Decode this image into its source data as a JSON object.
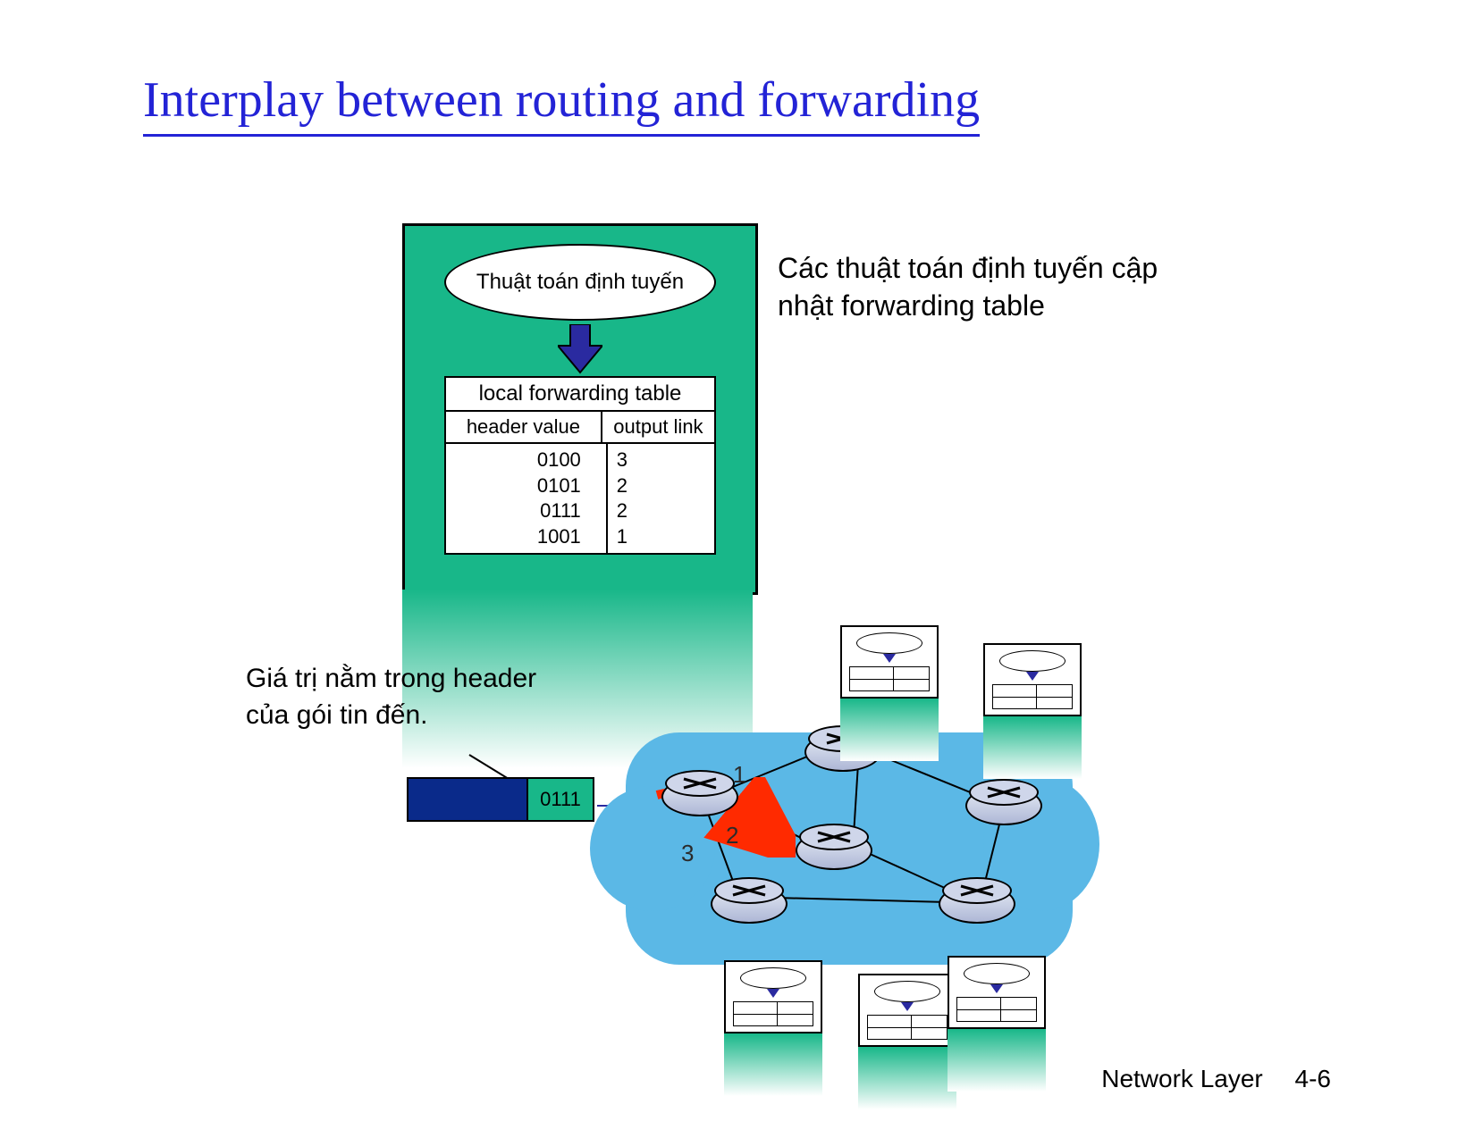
{
  "title": "Interplay between routing and forwarding",
  "caption_line1": "Các thuật toán định tuyến cập",
  "caption_line2": "nhật forwarding table",
  "routing_algorithm_label": "Thuật toán định tuyến",
  "forwarding_table": {
    "title": "local forwarding table",
    "col_header": "header value",
    "col_link": "output link",
    "rows": [
      {
        "header": "0100",
        "link": "3"
      },
      {
        "header": "0101",
        "link": "2"
      },
      {
        "header": "0111",
        "link": "2"
      },
      {
        "header": "1001",
        "link": "1"
      }
    ]
  },
  "packet_label_line1": "Giá trị nằm trong header",
  "packet_label_line2": "của gói tin đến.",
  "packet_header_value": "0111",
  "ports": {
    "p1": "1",
    "p2": "2",
    "p3": "3"
  },
  "footer_text": "Network Layer",
  "footer_page": "4-6"
}
